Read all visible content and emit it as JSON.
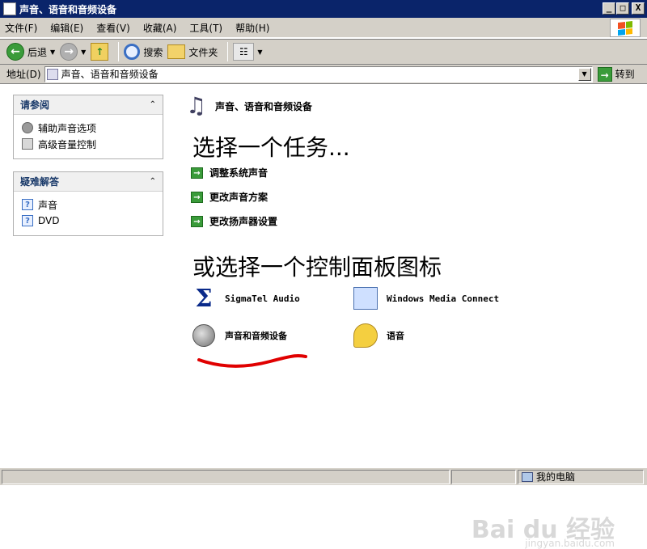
{
  "window": {
    "title": "声音、语音和音频设备",
    "buttons": {
      "minimize": "_",
      "maximize": "□",
      "close": "X"
    }
  },
  "menu": {
    "items": [
      "文件(F)",
      "编辑(E)",
      "查看(V)",
      "收藏(A)",
      "工具(T)",
      "帮助(H)"
    ]
  },
  "toolbar": {
    "back_label": "后退",
    "search_label": "搜索",
    "folders_label": "文件夹"
  },
  "address": {
    "label": "地址(D)",
    "value": "声音、语音和音频设备",
    "go_label": "转到"
  },
  "sidebar": {
    "see_also": {
      "title": "请参阅",
      "items": [
        {
          "label": "辅助声音选项",
          "icon": "speaker-icon"
        },
        {
          "label": "高级音量控制",
          "icon": "mixer-icon"
        }
      ]
    },
    "troubleshoot": {
      "title": "疑难解答",
      "items": [
        {
          "label": "声音",
          "icon": "help-icon"
        },
        {
          "label": "DVD",
          "icon": "help-icon"
        }
      ]
    }
  },
  "main": {
    "header": "声音、语音和音频设备",
    "pick_task": "选择一个任务...",
    "tasks": [
      "调整系统声音",
      "更改声音方案",
      "更改扬声器设置"
    ],
    "pick_icon": "或选择一个控制面板图标",
    "icons": [
      {
        "label": "SigmaTel Audio",
        "icon": "sigmatel-icon"
      },
      {
        "label": "Windows Media Connect",
        "icon": "media-connect-icon"
      },
      {
        "label": "声音和音频设备",
        "icon": "speaker-icon"
      },
      {
        "label": "语音",
        "icon": "speech-icon"
      }
    ]
  },
  "watermark": {
    "main": "Bai du 经验",
    "sub": "jingyan.baidu.com"
  },
  "status": {
    "zone": "我的电脑"
  },
  "colors": {
    "titlebar": "#0a246a",
    "chrome": "#d4d0c8",
    "task_arrow": "#3a9b3a",
    "annotation": "#e00000"
  }
}
